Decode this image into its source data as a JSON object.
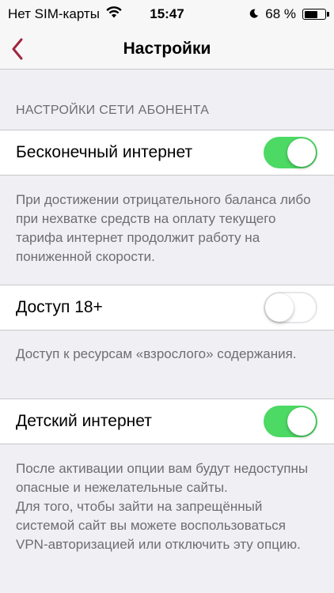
{
  "status_bar": {
    "carrier": "Нет SIM-карты",
    "time": "15:47",
    "battery_percent": "68 %",
    "battery_level": 0.68
  },
  "nav": {
    "title": "Настройки",
    "back_icon": "chevron-left-icon",
    "accent_color": "#a0263e"
  },
  "section": {
    "header": "НАСТРОЙКИ СЕТИ АБОНЕНТА"
  },
  "settings": [
    {
      "label": "Бесконечный интернет",
      "enabled": true,
      "description": "При достижении отрицательного баланса либо при нехватке средств на оплату текущего тарифа интернет продолжит работу на пониженной скорости."
    },
    {
      "label": "Доступ 18+",
      "enabled": false,
      "description": "Доступ к ресурсам «взрослого» содержания."
    },
    {
      "label": "Детский интернет",
      "enabled": true,
      "description": "После активации опции вам будут недоступны опасные и нежелательные сайты.\nДля того, чтобы зайти на запрещённый системой сайт вы можете воспользоваться VPN-авторизацией или отключить эту опцию."
    }
  ],
  "colors": {
    "toggle_on": "#4cd964",
    "background": "#efeff4"
  }
}
